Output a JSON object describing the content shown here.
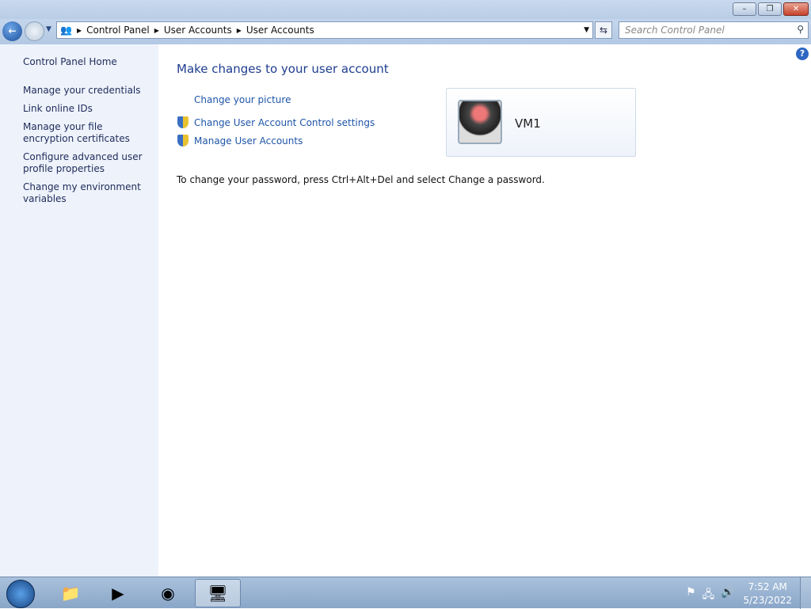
{
  "window": {
    "minimize": "–",
    "maximize": "❐",
    "close": "✕"
  },
  "nav": {
    "breadcrumb": [
      "Control Panel",
      "User Accounts",
      "User Accounts"
    ],
    "search_placeholder": "Search Control Panel"
  },
  "sidebar": {
    "items": [
      "Control Panel Home",
      "Manage your credentials",
      "Link online IDs",
      "Manage your file encryption certificates",
      "Configure advanced user profile properties",
      "Change my environment variables"
    ]
  },
  "main": {
    "title": "Make changes to your user account",
    "links": [
      "Change your picture",
      "Change User Account Control settings",
      "Manage User Accounts"
    ],
    "user_name": "VM1",
    "note": "To change your password, press Ctrl+Alt+Del and select Change a password."
  },
  "taskbar": {
    "time": "7:52 AM",
    "date": "5/23/2022"
  }
}
